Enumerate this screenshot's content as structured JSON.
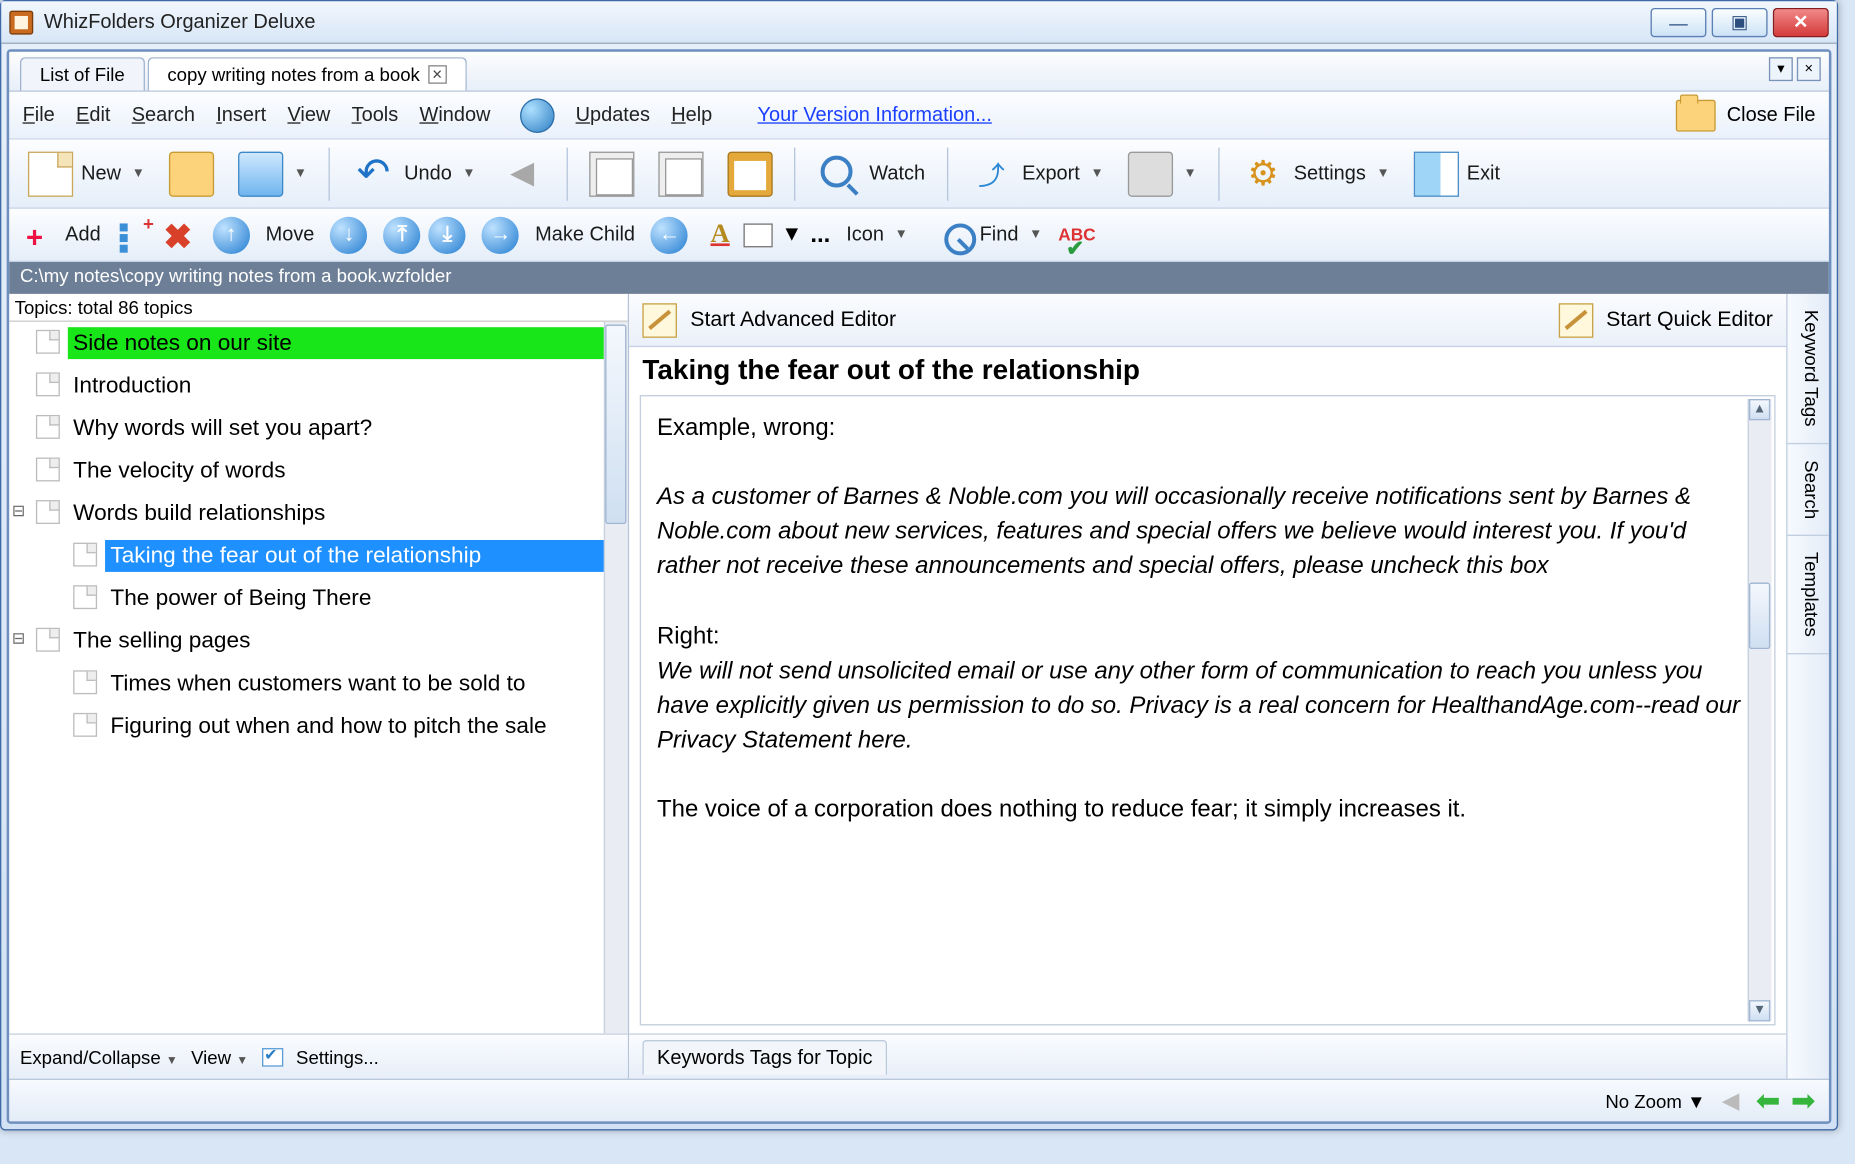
{
  "app": {
    "title": "WhizFolders Organizer Deluxe"
  },
  "tabs": {
    "list": "List of File",
    "active": "copy writing notes from a book"
  },
  "menus": {
    "file": "File",
    "edit": "Edit",
    "search": "Search",
    "insert": "Insert",
    "view": "View",
    "tools": "Tools",
    "window": "Window",
    "updates": "Updates",
    "help": "Help",
    "version_link": "Your Version Information...",
    "close_file": "Close File"
  },
  "toolbar": {
    "new": "New",
    "undo": "Undo",
    "watch": "Watch",
    "export": "Export",
    "settings": "Settings",
    "exit": "Exit"
  },
  "toolbar2": {
    "add": "Add",
    "move": "Move",
    "make_child": "Make Child",
    "icon": "Icon",
    "find": "Find",
    "abc": "ABC"
  },
  "pathbar": "C:\\my notes\\copy writing notes from a book.wzfolder",
  "topics": {
    "header": "Topics: total 86 topics",
    "items": [
      {
        "label": "Side notes on our site",
        "class": "green",
        "indent": 0,
        "exp": ""
      },
      {
        "label": "Introduction",
        "indent": 0,
        "exp": ""
      },
      {
        "label": "Why words will set you apart?",
        "indent": 0,
        "exp": ""
      },
      {
        "label": "The velocity of words",
        "indent": 0,
        "exp": ""
      },
      {
        "label": "Words build relationships",
        "indent": 0,
        "exp": "⊟"
      },
      {
        "label": "Taking the fear out of the relationship",
        "class": "sel",
        "indent": 1,
        "exp": ""
      },
      {
        "label": "The power of Being There",
        "indent": 1,
        "exp": ""
      },
      {
        "label": "The selling pages",
        "indent": 0,
        "exp": "⊟"
      },
      {
        "label": "Times when customers want to be sold to",
        "indent": 1,
        "exp": ""
      },
      {
        "label": "Figuring out when and how to pitch the sale",
        "indent": 1,
        "exp": ""
      }
    ],
    "footer": {
      "expand": "Expand/Collapse",
      "view": "View",
      "settings": "Settings..."
    }
  },
  "editor": {
    "advanced": "Start Advanced Editor",
    "quick": "Start Quick Editor",
    "title": "Taking the fear out of the relationship",
    "p1": "Example, wrong:",
    "p2": "As a customer of Barnes & Noble.com you will occasionally receive notifications sent by Barnes & Noble.com about new services, features and special offers we believe would interest you. If you'd rather not receive these announcements and special offers, please uncheck this box",
    "p3": "Right:",
    "p4": "We will not send unsolicited email or use any other form of communication to reach you unless you have explicitly given us permission to do so. Privacy is a real concern for HealthandAge.com--read our Privacy Statement here.",
    "p5": "The voice of a corporation does nothing to reduce fear; it simply increases it.",
    "keywords_tab": "Keywords Tags for Topic"
  },
  "sidetabs": {
    "kw": "Keyword Tags",
    "search": "Search",
    "templates": "Templates"
  },
  "bottom": {
    "zoom": "No Zoom"
  }
}
